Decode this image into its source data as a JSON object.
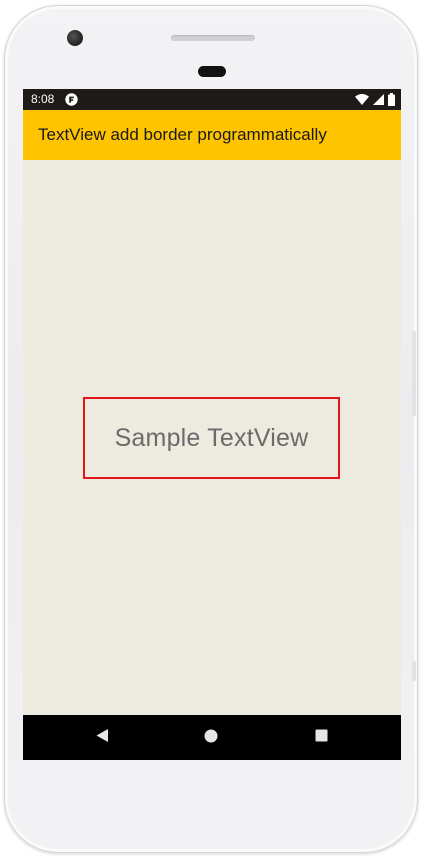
{
  "status_bar": {
    "time": "8:08",
    "left_icon": "app-notification-icon",
    "right_icons": [
      "wifi-icon",
      "signal-icon",
      "battery-icon"
    ]
  },
  "app_bar": {
    "title": "TextView add border programmatically",
    "background_color": "#ffc400"
  },
  "content": {
    "background_color": "#edeae0",
    "sample_textview": {
      "text": "Sample TextView",
      "border_color": "#e4141b",
      "text_color": "#6b6b6b"
    }
  },
  "nav_bar": {
    "buttons": [
      "back-icon",
      "home-icon",
      "recents-icon"
    ]
  }
}
